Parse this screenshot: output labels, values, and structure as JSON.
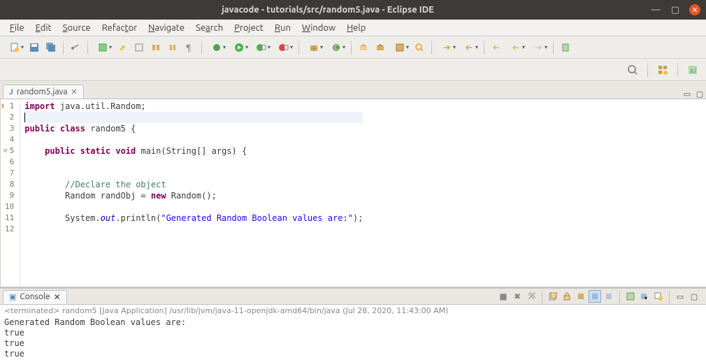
{
  "title": "javacode - tutorials/src/random5.java - Eclipse IDE",
  "menu": [
    "File",
    "Edit",
    "Source",
    "Refactor",
    "Navigate",
    "Search",
    "Project",
    "Run",
    "Window",
    "Help"
  ],
  "editor_tab": {
    "label": "random5.java",
    "close": "✕"
  },
  "code": {
    "lines": [
      {
        "n": "1",
        "mark": true,
        "html": "<span class='kw'>import</span> java.util.Random;"
      },
      {
        "n": "2",
        "cursor": true,
        "html": "<span class='cursor'></span>"
      },
      {
        "n": "3",
        "html": "<span class='kw'>public</span> <span class='kw'>class</span> random5 {"
      },
      {
        "n": "4",
        "html": ""
      },
      {
        "n": "5",
        "fold": true,
        "html": "    <span class='kw'>public</span> <span class='kw'>static</span> <span class='kw'>void</span> main(String[] args) {"
      },
      {
        "n": "6",
        "html": ""
      },
      {
        "n": "7",
        "html": ""
      },
      {
        "n": "8",
        "html": "        <span class='cmt'>//Declare the object</span>"
      },
      {
        "n": "9",
        "html": "        Random randObj = <span class='kw'>new</span> Random();"
      },
      {
        "n": "10",
        "html": ""
      },
      {
        "n": "11",
        "html": "        System.<span class='fld'>out</span>.println(<span class='str'>\"Generated Random Boolean values are:\"</span>);"
      },
      {
        "n": "12",
        "html": ""
      }
    ]
  },
  "console_tab": "Console",
  "console_header": "<terminated> random5 [Java Application] /usr/lib/jvm/java-11-openjdk-amd64/bin/java (Jul 28, 2020, 11:43:00 AM)",
  "console_output": "Generated Random Boolean values are:\ntrue\ntrue\ntrue"
}
